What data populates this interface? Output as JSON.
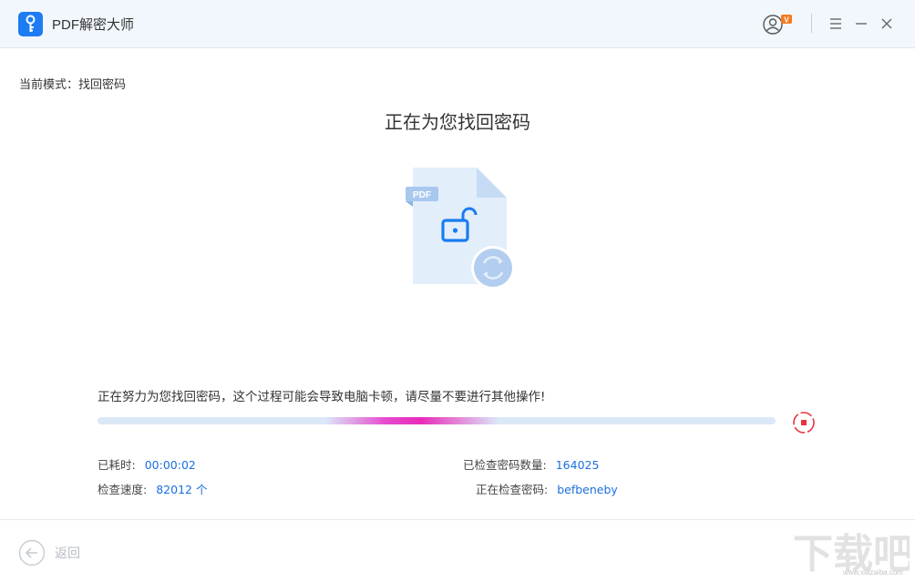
{
  "window": {
    "title": "PDF解密大师",
    "vip_badge": "V"
  },
  "mode": {
    "text": "当前模式：找回密码"
  },
  "main": {
    "headline": "正在为您找回密码",
    "file_badge": "PDF",
    "notice": "正在努力为您找回密码，这个过程可能会导致电脑卡顿，请尽量不要进行其他操作!"
  },
  "stats": {
    "elapsed_label": "已耗时:",
    "elapsed_value": "00:00:02",
    "speed_label": "检查速度:",
    "speed_value": "82012 个",
    "checked_label": "已检查密码数量:",
    "checked_value": "164025",
    "current_label": "正在检查密码:",
    "current_value": "befbeneby"
  },
  "footer": {
    "back_label": "返回",
    "watermark": "下载吧",
    "watermark_url": "www.xiazaiba.com"
  },
  "colors": {
    "accent": "#1a6fe0",
    "stop": "#e8343f",
    "badge": "#f47c20"
  }
}
